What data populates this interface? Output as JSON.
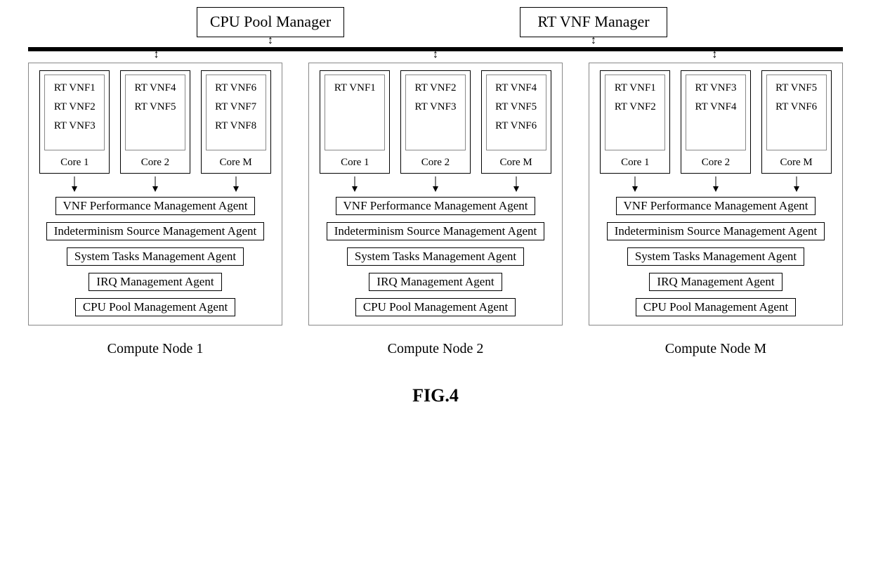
{
  "managers": {
    "cpu_pool": "CPU Pool Manager",
    "rt_vnf": "RT VNF Manager"
  },
  "nodes": [
    {
      "label": "Compute Node 1",
      "cores": [
        {
          "label": "Core 1",
          "vnfs": [
            "RT VNF1",
            "RT VNF2",
            "RT VNF3"
          ]
        },
        {
          "label": "Core 2",
          "vnfs": [
            "RT VNF4",
            "RT VNF5"
          ]
        },
        {
          "label": "Core M",
          "vnfs": [
            "RT VNF6",
            "RT VNF7",
            "RT VNF8"
          ]
        }
      ],
      "agents": [
        "VNF Performance Management Agent",
        "Indeterminism Source Management Agent",
        "System Tasks Management Agent",
        "IRQ Management Agent",
        "CPU Pool Management Agent"
      ]
    },
    {
      "label": "Compute Node 2",
      "cores": [
        {
          "label": "Core 1",
          "vnfs": [
            "RT VNF1"
          ]
        },
        {
          "label": "Core 2",
          "vnfs": [
            "RT VNF2",
            "RT VNF3"
          ]
        },
        {
          "label": "Core M",
          "vnfs": [
            "RT VNF4",
            "RT VNF5",
            "RT VNF6"
          ]
        }
      ],
      "agents": [
        "VNF Performance Management Agent",
        "Indeterminism Source Management Agent",
        "System Tasks Management Agent",
        "IRQ Management Agent",
        "CPU Pool Management Agent"
      ]
    },
    {
      "label": "Compute Node M",
      "cores": [
        {
          "label": "Core 1",
          "vnfs": [
            "RT VNF1",
            "RT VNF2"
          ]
        },
        {
          "label": "Core 2",
          "vnfs": [
            "RT VNF3",
            "RT VNF4"
          ]
        },
        {
          "label": "Core M",
          "vnfs": [
            "RT VNF5",
            "RT VNF6"
          ]
        }
      ],
      "agents": [
        "VNF Performance Management Agent",
        "Indeterminism Source Management Agent",
        "System Tasks Management Agent",
        "IRQ Management Agent",
        "CPU Pool Management Agent"
      ]
    }
  ],
  "figure_label": "FIG.4"
}
